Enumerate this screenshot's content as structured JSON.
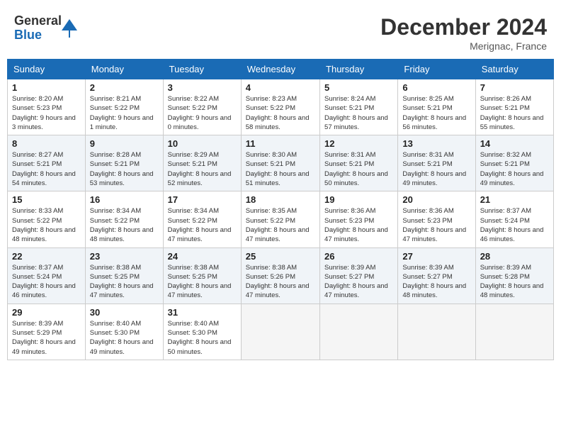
{
  "header": {
    "logo_general": "General",
    "logo_blue": "Blue",
    "month_title": "December 2024",
    "location": "Merignac, France"
  },
  "days_of_week": [
    "Sunday",
    "Monday",
    "Tuesday",
    "Wednesday",
    "Thursday",
    "Friday",
    "Saturday"
  ],
  "weeks": [
    [
      {
        "day": "1",
        "sunrise": "Sunrise: 8:20 AM",
        "sunset": "Sunset: 5:23 PM",
        "daylight": "Daylight: 9 hours and 3 minutes."
      },
      {
        "day": "2",
        "sunrise": "Sunrise: 8:21 AM",
        "sunset": "Sunset: 5:22 PM",
        "daylight": "Daylight: 9 hours and 1 minute."
      },
      {
        "day": "3",
        "sunrise": "Sunrise: 8:22 AM",
        "sunset": "Sunset: 5:22 PM",
        "daylight": "Daylight: 9 hours and 0 minutes."
      },
      {
        "day": "4",
        "sunrise": "Sunrise: 8:23 AM",
        "sunset": "Sunset: 5:22 PM",
        "daylight": "Daylight: 8 hours and 58 minutes."
      },
      {
        "day": "5",
        "sunrise": "Sunrise: 8:24 AM",
        "sunset": "Sunset: 5:21 PM",
        "daylight": "Daylight: 8 hours and 57 minutes."
      },
      {
        "day": "6",
        "sunrise": "Sunrise: 8:25 AM",
        "sunset": "Sunset: 5:21 PM",
        "daylight": "Daylight: 8 hours and 56 minutes."
      },
      {
        "day": "7",
        "sunrise": "Sunrise: 8:26 AM",
        "sunset": "Sunset: 5:21 PM",
        "daylight": "Daylight: 8 hours and 55 minutes."
      }
    ],
    [
      {
        "day": "8",
        "sunrise": "Sunrise: 8:27 AM",
        "sunset": "Sunset: 5:21 PM",
        "daylight": "Daylight: 8 hours and 54 minutes."
      },
      {
        "day": "9",
        "sunrise": "Sunrise: 8:28 AM",
        "sunset": "Sunset: 5:21 PM",
        "daylight": "Daylight: 8 hours and 53 minutes."
      },
      {
        "day": "10",
        "sunrise": "Sunrise: 8:29 AM",
        "sunset": "Sunset: 5:21 PM",
        "daylight": "Daylight: 8 hours and 52 minutes."
      },
      {
        "day": "11",
        "sunrise": "Sunrise: 8:30 AM",
        "sunset": "Sunset: 5:21 PM",
        "daylight": "Daylight: 8 hours and 51 minutes."
      },
      {
        "day": "12",
        "sunrise": "Sunrise: 8:31 AM",
        "sunset": "Sunset: 5:21 PM",
        "daylight": "Daylight: 8 hours and 50 minutes."
      },
      {
        "day": "13",
        "sunrise": "Sunrise: 8:31 AM",
        "sunset": "Sunset: 5:21 PM",
        "daylight": "Daylight: 8 hours and 49 minutes."
      },
      {
        "day": "14",
        "sunrise": "Sunrise: 8:32 AM",
        "sunset": "Sunset: 5:21 PM",
        "daylight": "Daylight: 8 hours and 49 minutes."
      }
    ],
    [
      {
        "day": "15",
        "sunrise": "Sunrise: 8:33 AM",
        "sunset": "Sunset: 5:22 PM",
        "daylight": "Daylight: 8 hours and 48 minutes."
      },
      {
        "day": "16",
        "sunrise": "Sunrise: 8:34 AM",
        "sunset": "Sunset: 5:22 PM",
        "daylight": "Daylight: 8 hours and 48 minutes."
      },
      {
        "day": "17",
        "sunrise": "Sunrise: 8:34 AM",
        "sunset": "Sunset: 5:22 PM",
        "daylight": "Daylight: 8 hours and 47 minutes."
      },
      {
        "day": "18",
        "sunrise": "Sunrise: 8:35 AM",
        "sunset": "Sunset: 5:22 PM",
        "daylight": "Daylight: 8 hours and 47 minutes."
      },
      {
        "day": "19",
        "sunrise": "Sunrise: 8:36 AM",
        "sunset": "Sunset: 5:23 PM",
        "daylight": "Daylight: 8 hours and 47 minutes."
      },
      {
        "day": "20",
        "sunrise": "Sunrise: 8:36 AM",
        "sunset": "Sunset: 5:23 PM",
        "daylight": "Daylight: 8 hours and 47 minutes."
      },
      {
        "day": "21",
        "sunrise": "Sunrise: 8:37 AM",
        "sunset": "Sunset: 5:24 PM",
        "daylight": "Daylight: 8 hours and 46 minutes."
      }
    ],
    [
      {
        "day": "22",
        "sunrise": "Sunrise: 8:37 AM",
        "sunset": "Sunset: 5:24 PM",
        "daylight": "Daylight: 8 hours and 46 minutes."
      },
      {
        "day": "23",
        "sunrise": "Sunrise: 8:38 AM",
        "sunset": "Sunset: 5:25 PM",
        "daylight": "Daylight: 8 hours and 47 minutes."
      },
      {
        "day": "24",
        "sunrise": "Sunrise: 8:38 AM",
        "sunset": "Sunset: 5:25 PM",
        "daylight": "Daylight: 8 hours and 47 minutes."
      },
      {
        "day": "25",
        "sunrise": "Sunrise: 8:38 AM",
        "sunset": "Sunset: 5:26 PM",
        "daylight": "Daylight: 8 hours and 47 minutes."
      },
      {
        "day": "26",
        "sunrise": "Sunrise: 8:39 AM",
        "sunset": "Sunset: 5:27 PM",
        "daylight": "Daylight: 8 hours and 47 minutes."
      },
      {
        "day": "27",
        "sunrise": "Sunrise: 8:39 AM",
        "sunset": "Sunset: 5:27 PM",
        "daylight": "Daylight: 8 hours and 48 minutes."
      },
      {
        "day": "28",
        "sunrise": "Sunrise: 8:39 AM",
        "sunset": "Sunset: 5:28 PM",
        "daylight": "Daylight: 8 hours and 48 minutes."
      }
    ],
    [
      {
        "day": "29",
        "sunrise": "Sunrise: 8:39 AM",
        "sunset": "Sunset: 5:29 PM",
        "daylight": "Daylight: 8 hours and 49 minutes."
      },
      {
        "day": "30",
        "sunrise": "Sunrise: 8:40 AM",
        "sunset": "Sunset: 5:30 PM",
        "daylight": "Daylight: 8 hours and 49 minutes."
      },
      {
        "day": "31",
        "sunrise": "Sunrise: 8:40 AM",
        "sunset": "Sunset: 5:30 PM",
        "daylight": "Daylight: 8 hours and 50 minutes."
      },
      null,
      null,
      null,
      null
    ]
  ]
}
